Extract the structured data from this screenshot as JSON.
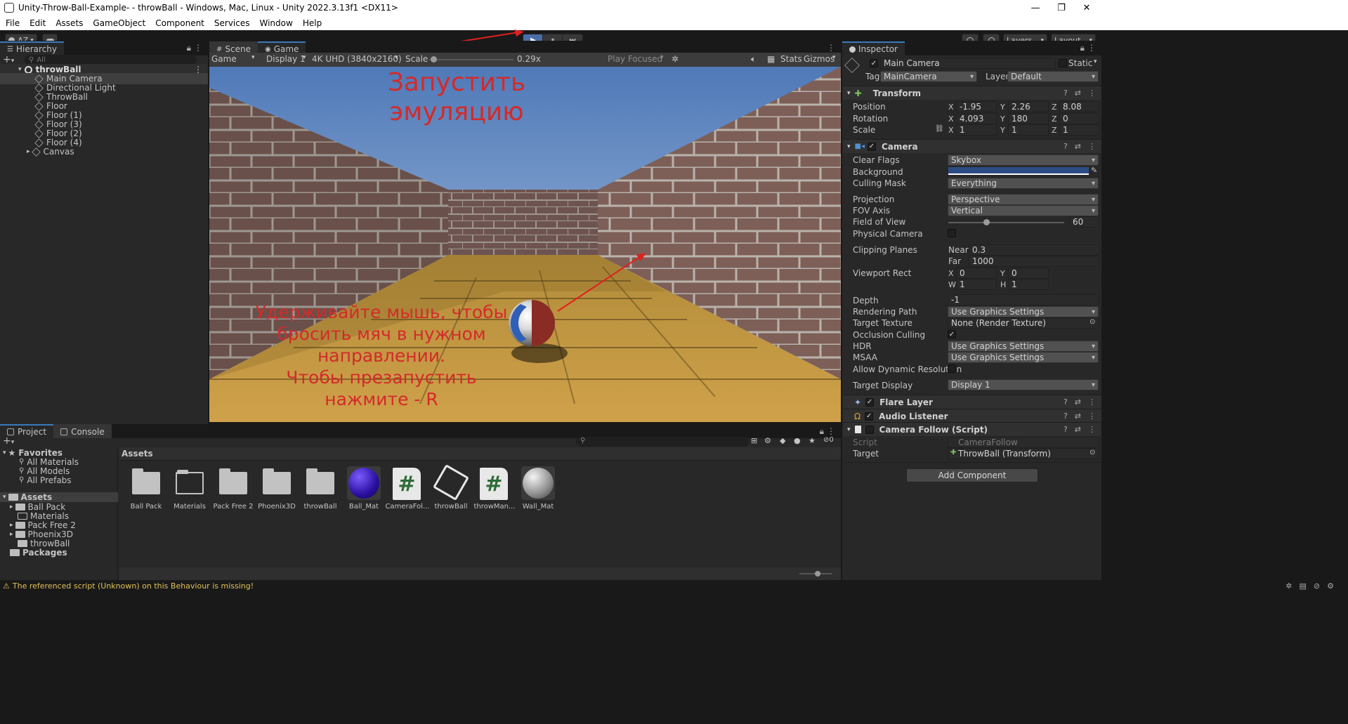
{
  "window": {
    "title": "Unity-Throw-Ball-Example- - throwBall - Windows, Mac, Linux - Unity 2022.3.13f1 <DX11>",
    "minimize": "—",
    "maximize": "❐",
    "close": "✕"
  },
  "menu": [
    "File",
    "Edit",
    "Assets",
    "GameObject",
    "Component",
    "Services",
    "Window",
    "Help"
  ],
  "toolbar": {
    "account": "AZ",
    "layers": "Layers",
    "layout": "Layout",
    "play": "▶",
    "pause": "⏸",
    "step": "⏭",
    "history_icon": "history-icon",
    "search_icon": "search-icon",
    "cloud_icon": "cloud-icon"
  },
  "hierarchy": {
    "tab": "Hierarchy",
    "search_placeholder": "All",
    "scene": "throwBall",
    "items": [
      "Main Camera",
      "Directional Light",
      "ThrowBall",
      "Floor",
      "Floor (1)",
      "Floor (3)",
      "Floor (2)",
      "Floor (4)",
      "Canvas"
    ]
  },
  "scene_tabs": {
    "scene": "Scene",
    "game": "Game",
    "view_dropdown": "Game",
    "display": "Display 1",
    "resolution": "4K UHD (3840x2160)",
    "scale_label": "Scale",
    "scale_value": "0.29x",
    "scale_fraction": 0.05,
    "play_focused": "Play Focused",
    "stats": "Stats",
    "gizmos": "Gizmos"
  },
  "annotations": {
    "top": "Запустить\nэмуляцию",
    "bottom_lines": [
      "Удерживайте мышь, чтобы",
      "бросить мяч в нужном",
      "направлении.",
      "Чтобы презапустить",
      "нажмите - R"
    ]
  },
  "inspector": {
    "tab": "Inspector",
    "object_name": "Main Camera",
    "static_label": "Static",
    "tag_label": "Tag",
    "tag_value": "MainCamera",
    "layer_label": "Layer",
    "layer_value": "Default",
    "transform": {
      "title": "Transform",
      "position_label": "Position",
      "position": [
        "-1.95",
        "2.26",
        "8.08"
      ],
      "rotation_label": "Rotation",
      "rotation": [
        "4.093",
        "180",
        "0"
      ],
      "scale_label": "Scale",
      "scale": [
        "1",
        "1",
        "1"
      ]
    },
    "camera": {
      "title": "Camera",
      "clear_flags_label": "Clear Flags",
      "clear_flags": "Skybox",
      "background_label": "Background",
      "background_color": "#2c4c85",
      "culling_mask_label": "Culling Mask",
      "culling_mask": "Everything",
      "projection_label": "Projection",
      "projection": "Perspective",
      "fov_axis_label": "FOV Axis",
      "fov_axis": "Vertical",
      "fov_label": "Field of View",
      "fov": "60",
      "fov_fraction": 0.33,
      "physical_label": "Physical Camera",
      "clipping_label": "Clipping Planes",
      "near_label": "Near",
      "near": "0.3",
      "far_label": "Far",
      "far": "1000",
      "viewport_label": "Viewport Rect",
      "vx": "0",
      "vy": "0",
      "vw": "1",
      "vh": "1",
      "depth_label": "Depth",
      "depth": "-1",
      "rendering_label": "Rendering Path",
      "rendering": "Use Graphics Settings",
      "target_texture_label": "Target Texture",
      "target_texture": "None (Render Texture)",
      "occlusion_label": "Occlusion Culling",
      "hdr_label": "HDR",
      "hdr": "Use Graphics Settings",
      "msaa_label": "MSAA",
      "msaa": "Use Graphics Settings",
      "dynres_label": "Allow Dynamic Resolution",
      "target_display_label": "Target Display",
      "target_display": "Display 1"
    },
    "flare_layer": "Flare Layer",
    "audio_listener": "Audio Listener",
    "camera_follow": {
      "title": "Camera Follow (Script)",
      "script_label": "Script",
      "script": "CameraFollow",
      "target_label": "Target",
      "target": "ThrowBall (Transform)"
    },
    "add_component": "Add Component"
  },
  "project": {
    "tab_project": "Project",
    "tab_console": "Console",
    "favorites": "Favorites",
    "fav_items": [
      "All Materials",
      "All Models",
      "All Prefabs"
    ],
    "assets_root": "Assets",
    "asset_folders": [
      "Ball Pack",
      "Materials",
      "Pack Free 2",
      "Phoenix3D",
      "throwBall"
    ],
    "packages": "Packages",
    "breadcrumb": "Assets",
    "hidden_count": "0",
    "grid": [
      "Ball Pack",
      "Materials",
      "Pack Free 2",
      "Phoenix3D",
      "throwBall",
      "Ball_Mat",
      "CameraFol...",
      "throwBall",
      "throwMan...",
      "Wall_Mat"
    ]
  },
  "status": {
    "message": "The referenced script (Unknown) on this Behaviour is missing!"
  }
}
